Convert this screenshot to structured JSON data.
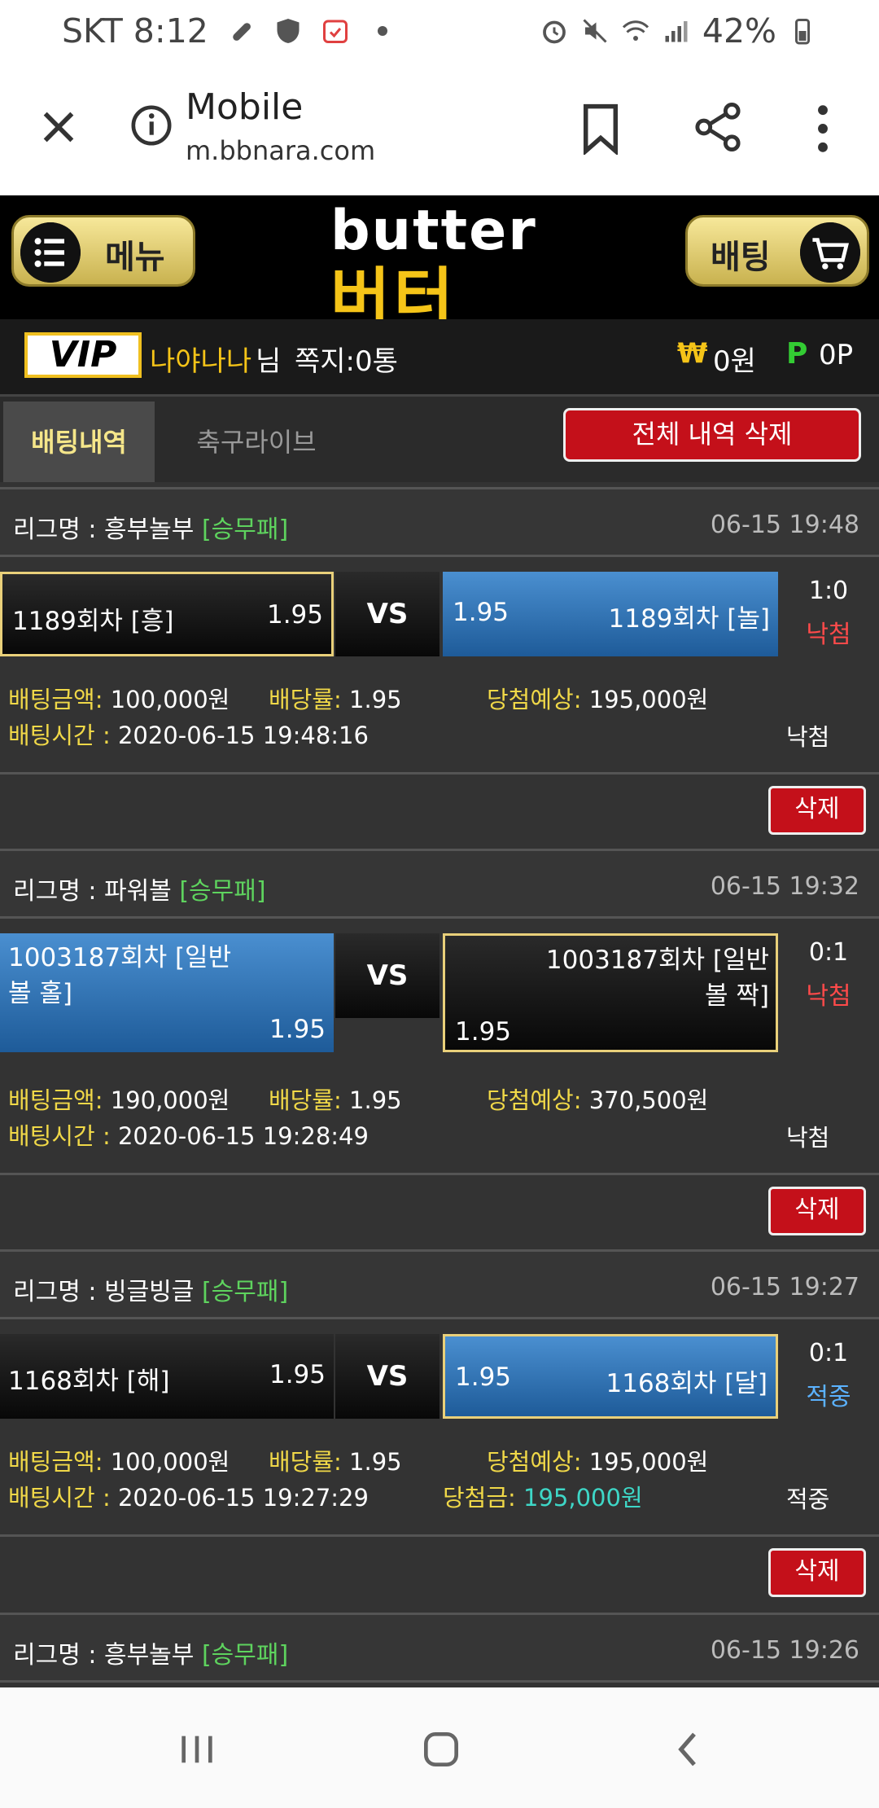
{
  "status_bar": {
    "carrier_time": "SKT 8:12",
    "battery": "42%",
    "left_icons": [
      "key-icon",
      "vpn-shield-icon",
      "calendar-icon",
      "dot-icon"
    ],
    "right_icons": [
      "alarm-icon",
      "mute-icon",
      "wifi-icon",
      "signal-icon",
      "battery-icon"
    ]
  },
  "browser": {
    "title": "Mobile",
    "url": "m.bbnara.com"
  },
  "header": {
    "menu_label": "메뉴",
    "logo_en": "butter",
    "logo_ko": "버터",
    "bet_label": "배팅"
  },
  "user": {
    "badge": "VIP",
    "name": "나야나나",
    "suffix": "님",
    "messages": "쪽지:0통",
    "money_symbol": "₩",
    "money": "0원",
    "points_symbol": "P",
    "points": "0P"
  },
  "tabs": {
    "history": "배팅내역",
    "soccer_live": "축구라이브",
    "delete_all": "전체 내역 삭제"
  },
  "colors": {
    "win": "#5bb2ff",
    "lose": "#ff4a4a",
    "accent_gold": "#f5c418",
    "delete_red": "#c4101a"
  },
  "records": [
    {
      "league_key": "리그명 : ",
      "league": "흥부놀부",
      "type": "[승무패]",
      "date": "06-15 19:48",
      "home": "1189회차 [흥]",
      "home_odds": "1.95",
      "vs": "VS",
      "away": "1189회차 [놀]",
      "away_odds": "1.95",
      "score": "1:0",
      "result": "낙첨",
      "amount_key": "배팅금액:",
      "amount": " 100,000원",
      "odds_key": "배당률:",
      "odds": " 1.95",
      "expect_key": "당첨예상:",
      "expect": " 195,000원",
      "time_key": "배팅시간 : ",
      "time": "2020-06-15 19:48:16",
      "status": "낙첨",
      "delete": "삭제"
    },
    {
      "league_key": "리그명 : ",
      "league": "파워볼",
      "type": "[승무패]",
      "date": "06-15 19:32",
      "home": "1003187회차 [일반볼 홀]",
      "home_odds": "1.95",
      "vs": "VS",
      "away": "1003187회차 [일반볼 짝]",
      "away_odds": "1.95",
      "score": "0:1",
      "result": "낙첨",
      "amount_key": "배팅금액:",
      "amount": " 190,000원",
      "odds_key": "배당률:",
      "odds": " 1.95",
      "expect_key": "당첨예상:",
      "expect": " 370,500원",
      "time_key": "배팅시간 : ",
      "time": "2020-06-15 19:28:49",
      "status": "낙첨",
      "delete": "삭제"
    },
    {
      "league_key": "리그명 : ",
      "league": "빙글빙글",
      "type": "[승무패]",
      "date": "06-15 19:27",
      "home": "1168회차 [해]",
      "home_odds": "1.95",
      "vs": "VS",
      "away": "1168회차 [달]",
      "away_odds": "1.95",
      "score": "0:1",
      "result": "적중",
      "amount_key": "배팅금액:",
      "amount": " 100,000원",
      "odds_key": "배당률:",
      "odds": " 1.95",
      "expect_key": "당첨예상:",
      "expect": " 195,000원",
      "time_key": "배팅시간 : ",
      "time": "2020-06-15 19:27:29",
      "win_key": "당첨금: ",
      "win_amount": "195,000원",
      "status": "적중",
      "delete": "삭제"
    },
    {
      "league_key": "리그명 : ",
      "league": "흥부놀부",
      "type": "[승무패]",
      "date": "06-15 19:26"
    }
  ]
}
